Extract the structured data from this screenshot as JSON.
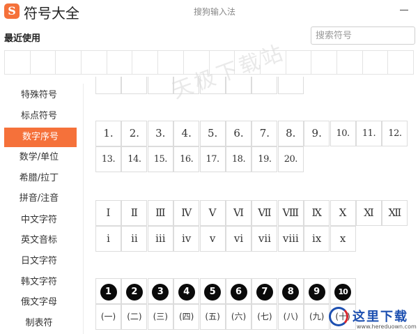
{
  "app": {
    "logo_letter": "S",
    "title": "符号大全",
    "subtitle": "搜狗输入法"
  },
  "recent": {
    "label": "最近使用"
  },
  "search": {
    "placeholder": "搜索符号"
  },
  "sidebar": {
    "items": [
      {
        "label": "特殊符号"
      },
      {
        "label": "标点符号"
      },
      {
        "label": "数字序号",
        "active": true
      },
      {
        "label": "数学/单位"
      },
      {
        "label": "希腊/拉丁"
      },
      {
        "label": "拼音/注音"
      },
      {
        "label": "中文字符"
      },
      {
        "label": "英文音标"
      },
      {
        "label": "日文字符"
      },
      {
        "label": "韩文字符"
      },
      {
        "label": "俄文字母"
      },
      {
        "label": "制表符"
      }
    ]
  },
  "groups": {
    "arabic_dot": [
      "1.",
      "2.",
      "3.",
      "4.",
      "5.",
      "6.",
      "7.",
      "8.",
      "9.",
      "10.",
      "11.",
      "12.",
      "13.",
      "14.",
      "15.",
      "16.",
      "17.",
      "18.",
      "19.",
      "20."
    ],
    "roman_upper": [
      "Ⅰ",
      "Ⅱ",
      "Ⅲ",
      "Ⅳ",
      "Ⅴ",
      "Ⅵ",
      "Ⅶ",
      "Ⅷ",
      "Ⅸ",
      "Ⅹ",
      "Ⅺ",
      "Ⅻ"
    ],
    "roman_lower": [
      "ⅰ",
      "ⅱ",
      "ⅲ",
      "ⅳ",
      "ⅴ",
      "ⅵ",
      "ⅶ",
      "ⅷ",
      "ⅸ",
      "ⅹ"
    ],
    "circled_neg": [
      "1",
      "2",
      "3",
      "4",
      "5",
      "6",
      "7",
      "8",
      "9",
      "10"
    ],
    "paren_cjk": [
      "(一)",
      "(二)",
      "(三)",
      "(四)",
      "(五)",
      "(六)",
      "(七)",
      "(八)",
      "(九)",
      "(十)"
    ]
  },
  "watermark": "天极下载站",
  "site_logo": {
    "text": "这里下载",
    "url": "www.hereduown.com"
  },
  "colors": {
    "accent": "#f5713a",
    "grid_border": "#dcdcdc"
  }
}
